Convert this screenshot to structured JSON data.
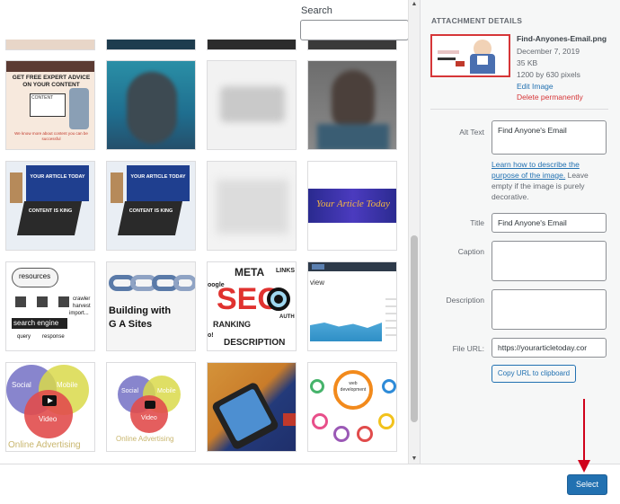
{
  "search": {
    "label": "Search",
    "value": ""
  },
  "tiles": {
    "advice": {
      "headline": "GET FREE EXPERT ADVICE ON YOUR CONTENT",
      "tagline": "CONTENT",
      "sub": "We know more about content you can be successful"
    },
    "blurred": "",
    "laptop1": {
      "title": "YOUR ARTICLE TODAY",
      "content": "CONTENT IS KING"
    },
    "laptop2": {
      "title": "YOUR ARTICLE TODAY",
      "content": "CONTENT IS KING"
    },
    "banner": {
      "text": "Your Article Today"
    },
    "search_engine": {
      "resources": "resources",
      "crawler": "crawler",
      "harvest": "harvest",
      "import": "import...",
      "engine": "search engine",
      "query": "query",
      "response": "response"
    },
    "chain": {
      "line1": "Building with",
      "line2": "G A Sites"
    },
    "seo": {
      "meta": "META",
      "links": "LINKS",
      "google": "oogle",
      "seo": "SEO",
      "ranking": "RANKING",
      "auth": "AUTH",
      "description": "DESCRIPTION",
      "o": "o!"
    },
    "dashboard": {
      "view": "view",
      "badge": ""
    },
    "venn1": {
      "social": "Social",
      "mobile": "Mobile",
      "video": "Video",
      "caption": "Online Advertising"
    },
    "venn2": {
      "social": "Social",
      "mobile": "Mobile",
      "video": "Video",
      "caption": "Online Advertising"
    },
    "webdev": {
      "center": "web development"
    }
  },
  "details": {
    "heading": "ATTACHMENT DETAILS",
    "filename": "Find-Anyones-Email.png",
    "date": "December 7, 2019",
    "size": "35 KB",
    "dimensions": "1200 by 630 pixels",
    "edit_link": "Edit Image",
    "delete_link": "Delete permanently",
    "alt_label": "Alt Text",
    "alt_value": "Find Anyone's Email",
    "help_link": "Learn how to describe the purpose of the image.",
    "help_rest": " Leave empty if the image is purely decorative.",
    "title_label": "Title",
    "title_value": "Find Anyone's Email",
    "caption_label": "Caption",
    "caption_value": "",
    "description_label": "Description",
    "description_value": "",
    "url_label": "File URL:",
    "url_value": "https://yourarticletoday.cor",
    "copy_button": "Copy URL to clipboard"
  },
  "footer": {
    "select_button": "Select"
  },
  "colors": {
    "primary": "#2271b1",
    "danger": "#d63638",
    "arrow": "#d0021b"
  }
}
